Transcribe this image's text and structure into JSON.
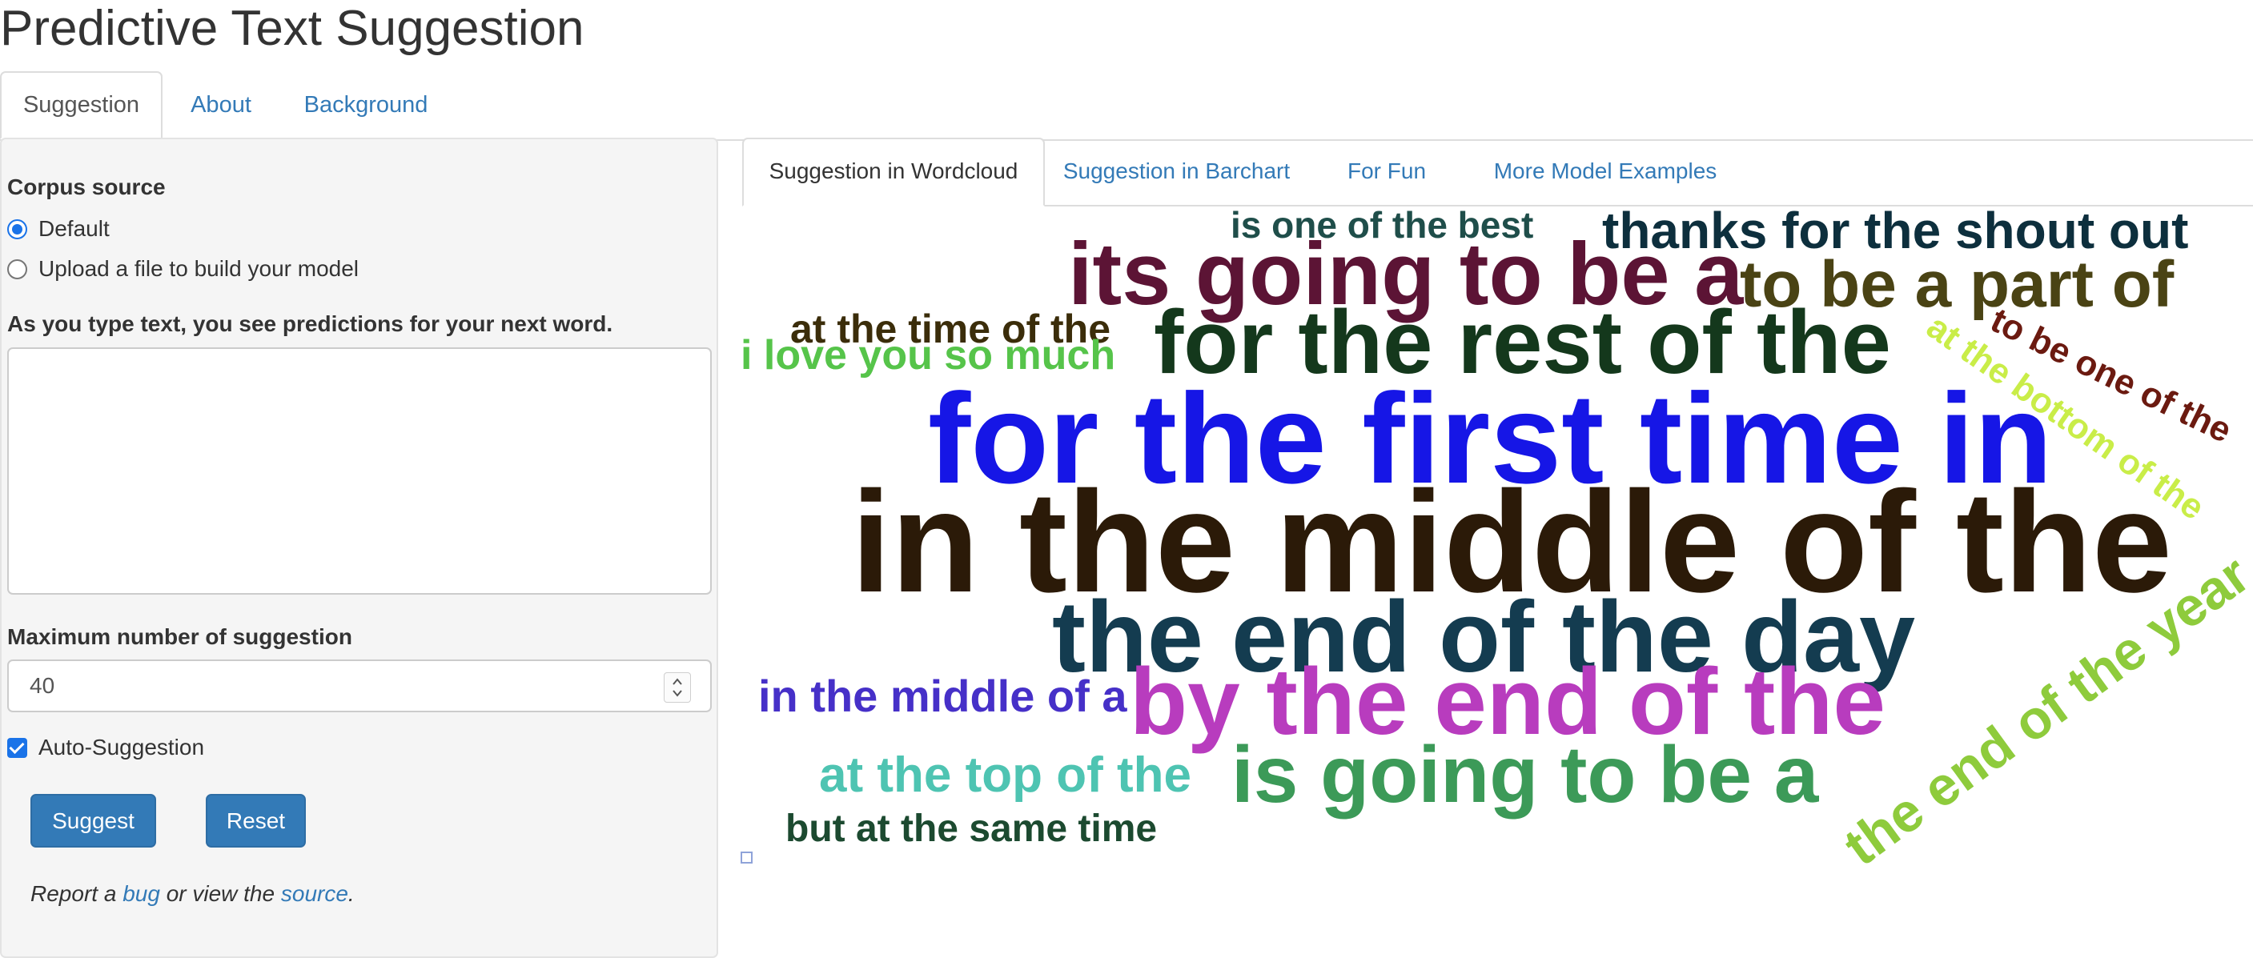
{
  "page": {
    "title": "Predictive Text Suggestion"
  },
  "top_tabs": [
    {
      "label": "Suggestion",
      "active": true
    },
    {
      "label": "About",
      "active": false
    },
    {
      "label": "Background",
      "active": false
    }
  ],
  "sidebar": {
    "corpus_label": "Corpus source",
    "corpus_options": [
      {
        "label": "Default",
        "checked": true
      },
      {
        "label": "Upload a file to build your model",
        "checked": false
      }
    ],
    "text_label": "As you type text, you see predictions for your next word.",
    "text_value": "",
    "max_label": "Maximum number of suggestion",
    "max_value": "40",
    "auto_label": "Auto-Suggestion",
    "auto_checked": true,
    "suggest_button": "Suggest",
    "reset_button": "Reset",
    "report": {
      "prefix": "Report a",
      "bug_link": "bug",
      "middle": "or view the",
      "source_link": "source",
      "suffix": "."
    }
  },
  "content_tabs": [
    {
      "label": "Suggestion in Wordcloud",
      "active": true
    },
    {
      "label": "Suggestion in Barchart",
      "active": false
    },
    {
      "label": "For Fun",
      "active": false
    },
    {
      "label": "More Model Examples",
      "active": false
    }
  ],
  "wordcloud": {
    "phrases": [
      {
        "text": "is one of the best",
        "color": "#1f4e4a"
      },
      {
        "text": "thanks for the shout out",
        "color": "#0d2f3d"
      },
      {
        "text": "its going to be a",
        "color": "#5c1435"
      },
      {
        "text": "to be a part of",
        "color": "#4a4314"
      },
      {
        "text": "at the time of the",
        "color": "#3b2d0a"
      },
      {
        "text": "i love you so much",
        "color": "#56c44a"
      },
      {
        "text": "for the rest of the",
        "color": "#14381c"
      },
      {
        "text": "to be one of the",
        "color": "#6b1a10"
      },
      {
        "text": "at the bottom of the",
        "color": "#c9ed48"
      },
      {
        "text": "for the first time in",
        "color": "#1616e6"
      },
      {
        "text": "in the middle of the",
        "color": "#2b1a08"
      },
      {
        "text": "the end of the year",
        "color": "#8ecb3c"
      },
      {
        "text": "the end of the day",
        "color": "#143c50"
      },
      {
        "text": "in the middle of a",
        "color": "#4630c8"
      },
      {
        "text": "by the end of the",
        "color": "#b83cbe"
      },
      {
        "text": "at the top of the",
        "color": "#4ec4b2"
      },
      {
        "text": "is going to be a",
        "color": "#3c9a58"
      },
      {
        "text": "the end of the",
        "color": "#8ecb3c"
      },
      {
        "text": "but at the same time",
        "color": "#1c4a30"
      }
    ]
  }
}
